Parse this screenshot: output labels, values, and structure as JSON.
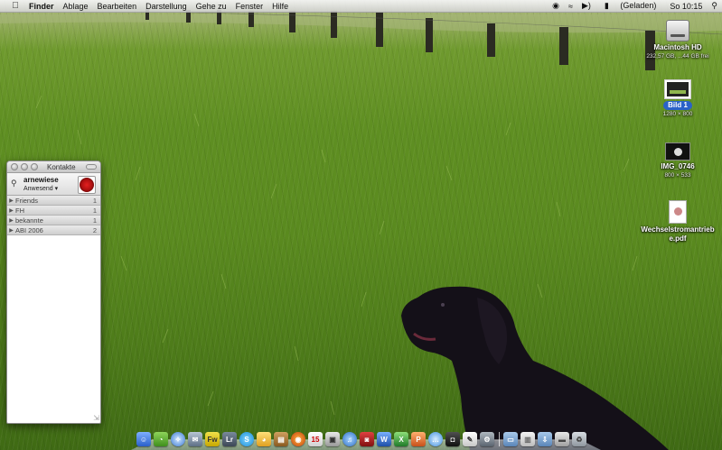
{
  "menubar": {
    "apple": "",
    "app": "Finder",
    "menus": [
      "Ablage",
      "Bearbeiten",
      "Darstellung",
      "Gehe zu",
      "Fenster",
      "Hilfe"
    ],
    "battery": "(Geladen)",
    "clock": "So 10:15"
  },
  "desktop": {
    "hd": {
      "name": "Macintosh HD",
      "sub": "232,57 GB, ...44 GB frei"
    },
    "bild": {
      "name": "Bild 1",
      "sub": "1280 × 800"
    },
    "img": {
      "name": "IMG_0746",
      "sub": "800 × 533"
    },
    "pdf": {
      "name": "Wechselstromantrieb",
      "name2": "e.pdf"
    }
  },
  "contacts": {
    "title": "Kontakte",
    "account": {
      "name": "arnewiese",
      "status": "Anwesend ▾"
    },
    "groups": [
      {
        "label": "Friends",
        "count": "1"
      },
      {
        "label": "FH",
        "count": "1"
      },
      {
        "label": "bekannte",
        "count": "1"
      },
      {
        "label": "ABI 2006",
        "count": "2"
      }
    ]
  },
  "dock": {
    "apps": [
      "finder",
      "dashboard",
      "safari",
      "mail",
      "fireworks",
      "lightroom",
      "skype",
      "adium",
      "books",
      "firefox",
      "ical",
      "preview",
      "itunes",
      "photo-booth",
      "word",
      "excel",
      "powerpoint",
      "ichat",
      "camera",
      "textedit",
      "system-preferences"
    ],
    "tail": [
      "folder",
      "documents",
      "downloads",
      "drive",
      "trash"
    ]
  },
  "colors": {
    "selection": "#2a62c9",
    "grass": "#5f8f22"
  }
}
